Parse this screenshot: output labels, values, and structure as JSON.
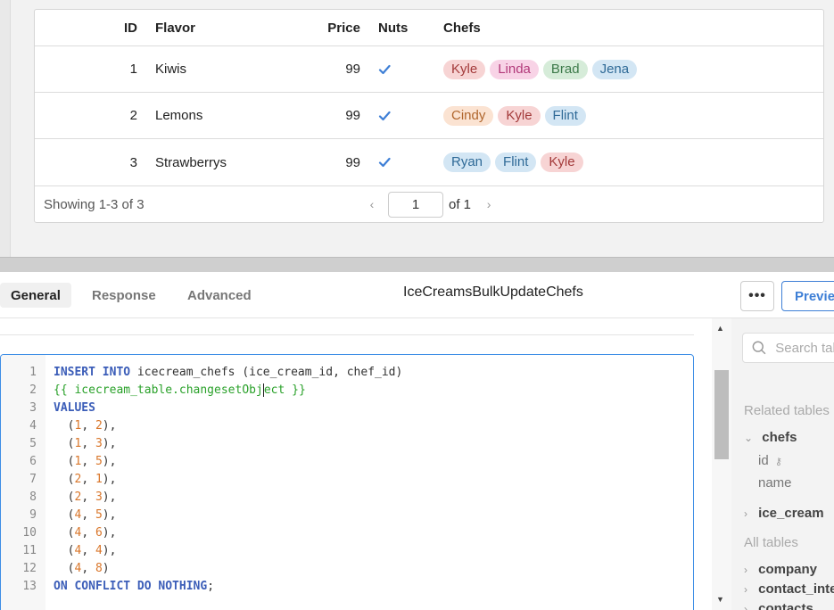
{
  "table": {
    "columns": [
      "ID",
      "Flavor",
      "Price",
      "Nuts",
      "Chefs"
    ],
    "rows": [
      {
        "id": "1",
        "flavor": "Kiwis",
        "price": "99",
        "nuts": true,
        "chefs": [
          "Kyle",
          "Linda",
          "Brad",
          "Jena"
        ]
      },
      {
        "id": "2",
        "flavor": "Lemons",
        "price": "99",
        "nuts": true,
        "chefs": [
          "Cindy",
          "Kyle",
          "Flint"
        ]
      },
      {
        "id": "3",
        "flavor": "Strawberrys",
        "price": "99",
        "nuts": true,
        "chefs": [
          "Ryan",
          "Flint",
          "Kyle"
        ]
      }
    ],
    "chef_colors": {
      "Kyle": {
        "bg": "#f7d4d4",
        "fg": "#a33a3a"
      },
      "Linda": {
        "bg": "#f8d3e6",
        "fg": "#b23a7a"
      },
      "Brad": {
        "bg": "#d6ecd9",
        "fg": "#3d7a4a"
      },
      "Jena": {
        "bg": "#d3e6f4",
        "fg": "#2f6a97"
      },
      "Cindy": {
        "bg": "#fbe3d2",
        "fg": "#b0662d"
      },
      "Flint": {
        "bg": "#d3e6f4",
        "fg": "#2f6a97"
      },
      "Ryan": {
        "bg": "#d3e6f4",
        "fg": "#2f6a97"
      }
    },
    "footer": {
      "showing": "Showing 1-3 of 3",
      "page": "1",
      "of": "of 1"
    }
  },
  "query_panel": {
    "tabs": [
      "General",
      "Response",
      "Advanced"
    ],
    "active_tab": "General",
    "query_name": "IceCreamsBulkUpdateChefs",
    "more_label": "•••",
    "preview_label": "Preview",
    "code_lines": [
      [
        "1",
        [
          [
            "kw",
            "INSERT INTO"
          ],
          [
            "txt",
            " icecream_chefs (ice_cream_id, chef_id)"
          ]
        ]
      ],
      [
        "2",
        [
          [
            "tpl",
            "{{ icecream_table.changesetObj"
          ],
          [
            "cursor",
            ""
          ],
          [
            "tpl",
            "ect }}"
          ]
        ]
      ],
      [
        "3",
        [
          [
            "kw",
            "VALUES"
          ]
        ]
      ],
      [
        "4",
        [
          [
            "txt",
            "  ("
          ],
          [
            "num",
            "1"
          ],
          [
            "txt",
            ", "
          ],
          [
            "num",
            "2"
          ],
          [
            "txt",
            "),"
          ]
        ]
      ],
      [
        "5",
        [
          [
            "txt",
            "  ("
          ],
          [
            "num",
            "1"
          ],
          [
            "txt",
            ", "
          ],
          [
            "num",
            "3"
          ],
          [
            "txt",
            "),"
          ]
        ]
      ],
      [
        "6",
        [
          [
            "txt",
            "  ("
          ],
          [
            "num",
            "1"
          ],
          [
            "txt",
            ", "
          ],
          [
            "num",
            "5"
          ],
          [
            "txt",
            "),"
          ]
        ]
      ],
      [
        "7",
        [
          [
            "txt",
            "  ("
          ],
          [
            "num",
            "2"
          ],
          [
            "txt",
            ", "
          ],
          [
            "num",
            "1"
          ],
          [
            "txt",
            "),"
          ]
        ]
      ],
      [
        "8",
        [
          [
            "txt",
            "  ("
          ],
          [
            "num",
            "2"
          ],
          [
            "txt",
            ", "
          ],
          [
            "num",
            "3"
          ],
          [
            "txt",
            "),"
          ]
        ]
      ],
      [
        "9",
        [
          [
            "txt",
            "  ("
          ],
          [
            "num",
            "4"
          ],
          [
            "txt",
            ", "
          ],
          [
            "num",
            "5"
          ],
          [
            "txt",
            "),"
          ]
        ]
      ],
      [
        "10",
        [
          [
            "txt",
            "  ("
          ],
          [
            "num",
            "4"
          ],
          [
            "txt",
            ", "
          ],
          [
            "num",
            "6"
          ],
          [
            "txt",
            "),"
          ]
        ]
      ],
      [
        "11",
        [
          [
            "txt",
            "  ("
          ],
          [
            "num",
            "4"
          ],
          [
            "txt",
            ", "
          ],
          [
            "num",
            "4"
          ],
          [
            "txt",
            "),"
          ]
        ]
      ],
      [
        "12",
        [
          [
            "txt",
            "  ("
          ],
          [
            "num",
            "4"
          ],
          [
            "txt",
            ", "
          ],
          [
            "num",
            "8"
          ],
          [
            "txt",
            ")"
          ]
        ]
      ],
      [
        "13",
        [
          [
            "kw",
            "ON CONFLICT DO NOTHING"
          ],
          [
            "txt",
            ";"
          ]
        ]
      ]
    ]
  },
  "side_panel": {
    "search_placeholder": "Search tables",
    "related_heading": "Related tables",
    "chefs_table": "chefs",
    "chefs_fields": [
      "id",
      "name"
    ],
    "ice_cream_table": "ice_cream",
    "all_heading": "All tables",
    "all_tables": [
      "company",
      "contact_interactions",
      "contacts"
    ]
  }
}
